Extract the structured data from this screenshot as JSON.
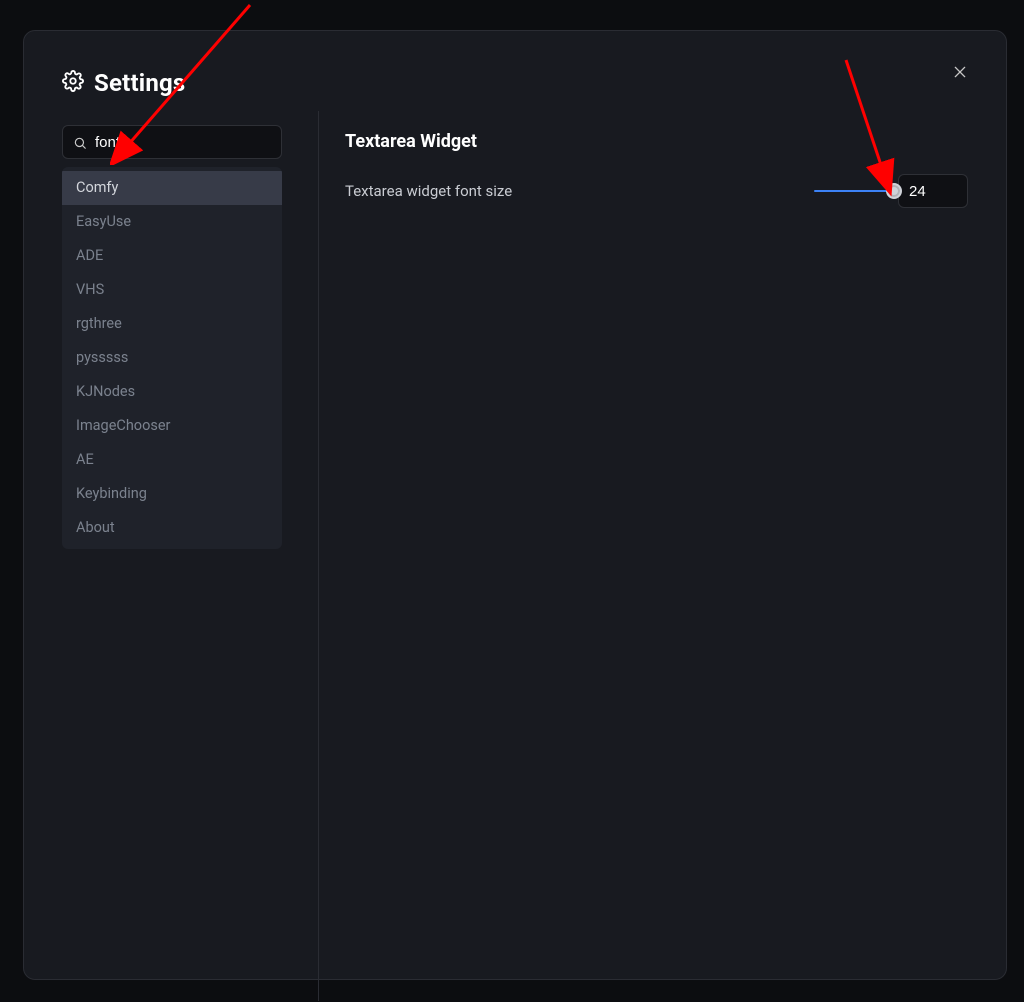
{
  "title": "Settings",
  "search": {
    "value": "font"
  },
  "sidebar": {
    "items": [
      {
        "label": "Comfy",
        "selected": true
      },
      {
        "label": "EasyUse",
        "selected": false
      },
      {
        "label": "ADE",
        "selected": false
      },
      {
        "label": "VHS",
        "selected": false
      },
      {
        "label": "rgthree",
        "selected": false
      },
      {
        "label": "pysssss",
        "selected": false
      },
      {
        "label": "KJNodes",
        "selected": false
      },
      {
        "label": "ImageChooser",
        "selected": false
      },
      {
        "label": "AE",
        "selected": false
      },
      {
        "label": "Keybinding",
        "selected": false
      },
      {
        "label": "About",
        "selected": false
      }
    ]
  },
  "content": {
    "section_title": "Textarea Widget",
    "settings": [
      {
        "label": "Textarea widget font size",
        "value": "24"
      }
    ]
  },
  "colors": {
    "accent": "#3c82f6",
    "bg": "#181a20",
    "border": "#2a2c33"
  }
}
